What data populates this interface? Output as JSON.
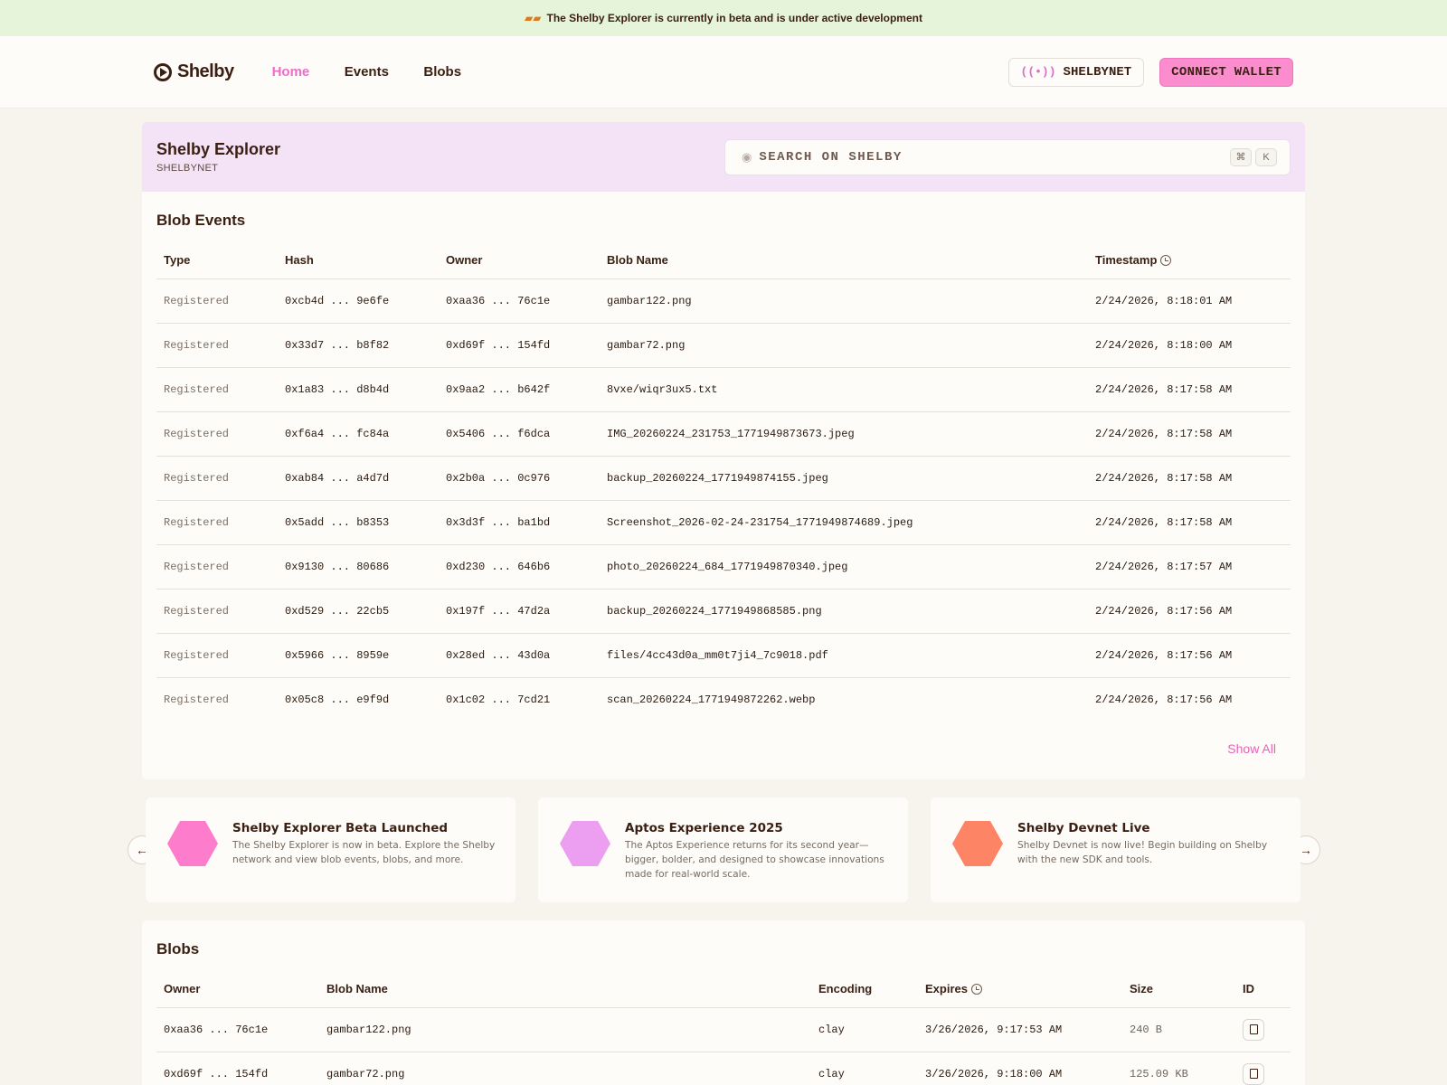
{
  "banner": {
    "icon": "construction-icon",
    "text": "The Shelby Explorer is currently in beta and is under active development"
  },
  "header": {
    "logo": "Shelby",
    "nav": [
      {
        "label": "Home",
        "active": true
      },
      {
        "label": "Events"
      },
      {
        "label": "Blobs"
      }
    ],
    "network": "SHELBYNET",
    "wallet": "CONNECT WALLET"
  },
  "explorer": {
    "title": "Shelby Explorer",
    "subtitle": "SHELBYNET",
    "search_placeholder": "SEARCH ON SHELBY",
    "shortcut": [
      "⌘",
      "K"
    ]
  },
  "events": {
    "title": "Blob Events",
    "columns": [
      "Type",
      "Hash",
      "Owner",
      "Blob Name",
      "Timestamp"
    ],
    "rows": [
      {
        "type": "Registered",
        "hash": "0xcb4d ... 9e6fe",
        "owner": "0xaa36 ... 76c1e",
        "name": "gambar122.png",
        "time": "2/24/2026, 8:18:01 AM"
      },
      {
        "type": "Registered",
        "hash": "0x33d7 ... b8f82",
        "owner": "0xd69f ... 154fd",
        "name": "gambar72.png",
        "time": "2/24/2026, 8:18:00 AM"
      },
      {
        "type": "Registered",
        "hash": "0x1a83 ... d8b4d",
        "owner": "0x9aa2 ... b642f",
        "name": "8vxe/wiqr3ux5.txt",
        "time": "2/24/2026, 8:17:58 AM"
      },
      {
        "type": "Registered",
        "hash": "0xf6a4 ... fc84a",
        "owner": "0x5406 ... f6dca",
        "name": "IMG_20260224_231753_1771949873673.jpeg",
        "time": "2/24/2026, 8:17:58 AM"
      },
      {
        "type": "Registered",
        "hash": "0xab84 ... a4d7d",
        "owner": "0x2b0a ... 0c976",
        "name": "backup_20260224_1771949874155.jpeg",
        "time": "2/24/2026, 8:17:58 AM"
      },
      {
        "type": "Registered",
        "hash": "0x5add ... b8353",
        "owner": "0x3d3f ... ba1bd",
        "name": "Screenshot_2026-02-24-231754_1771949874689.jpeg",
        "time": "2/24/2026, 8:17:58 AM"
      },
      {
        "type": "Registered",
        "hash": "0x9130 ... 80686",
        "owner": "0xd230 ... 646b6",
        "name": "photo_20260224_684_1771949870340.jpeg",
        "time": "2/24/2026, 8:17:57 AM"
      },
      {
        "type": "Registered",
        "hash": "0xd529 ... 22cb5",
        "owner": "0x197f ... 47d2a",
        "name": "backup_20260224_1771949868585.png",
        "time": "2/24/2026, 8:17:56 AM"
      },
      {
        "type": "Registered",
        "hash": "0x5966 ... 8959e",
        "owner": "0x28ed ... 43d0a",
        "name": "files/4cc43d0a_mm0t7ji4_7c9018.pdf",
        "time": "2/24/2026, 8:17:56 AM"
      },
      {
        "type": "Registered",
        "hash": "0x05c8 ... e9f9d",
        "owner": "0x1c02 ... 7cd21",
        "name": "scan_20260224_1771949872262.webp",
        "time": "2/24/2026, 8:17:56 AM"
      }
    ],
    "show_all": "Show All"
  },
  "cards": [
    {
      "title": "Shelby Explorer Beta Launched",
      "desc": "The Shelby Explorer is now in beta. Explore the Shelby network and view blob events, blobs, and more.",
      "color": "#fd7ccb"
    },
    {
      "title": "Aptos Experience 2025",
      "desc": "The Aptos Experience returns for its second year—bigger, bolder, and designed to showcase innovations made for real-world scale.",
      "color": "#ec9ef0"
    },
    {
      "title": "Shelby Devnet Live",
      "desc": "Shelby Devnet is now live! Begin building on Shelby with the new SDK and tools.",
      "color": "#fd8465"
    }
  ],
  "blobs": {
    "title": "Blobs",
    "columns": [
      "Owner",
      "Blob Name",
      "Encoding",
      "Expires",
      "Size",
      "ID"
    ],
    "rows": [
      {
        "owner": "0xaa36 ... 76c1e",
        "name": "gambar122.png",
        "encoding": "clay",
        "expires": "3/26/2026, 9:17:53 AM",
        "size": "240 B"
      },
      {
        "owner": "0xd69f ... 154fd",
        "name": "gambar72.png",
        "encoding": "clay",
        "expires": "3/26/2026, 9:18:00 AM",
        "size": "125.09 KB"
      }
    ]
  }
}
